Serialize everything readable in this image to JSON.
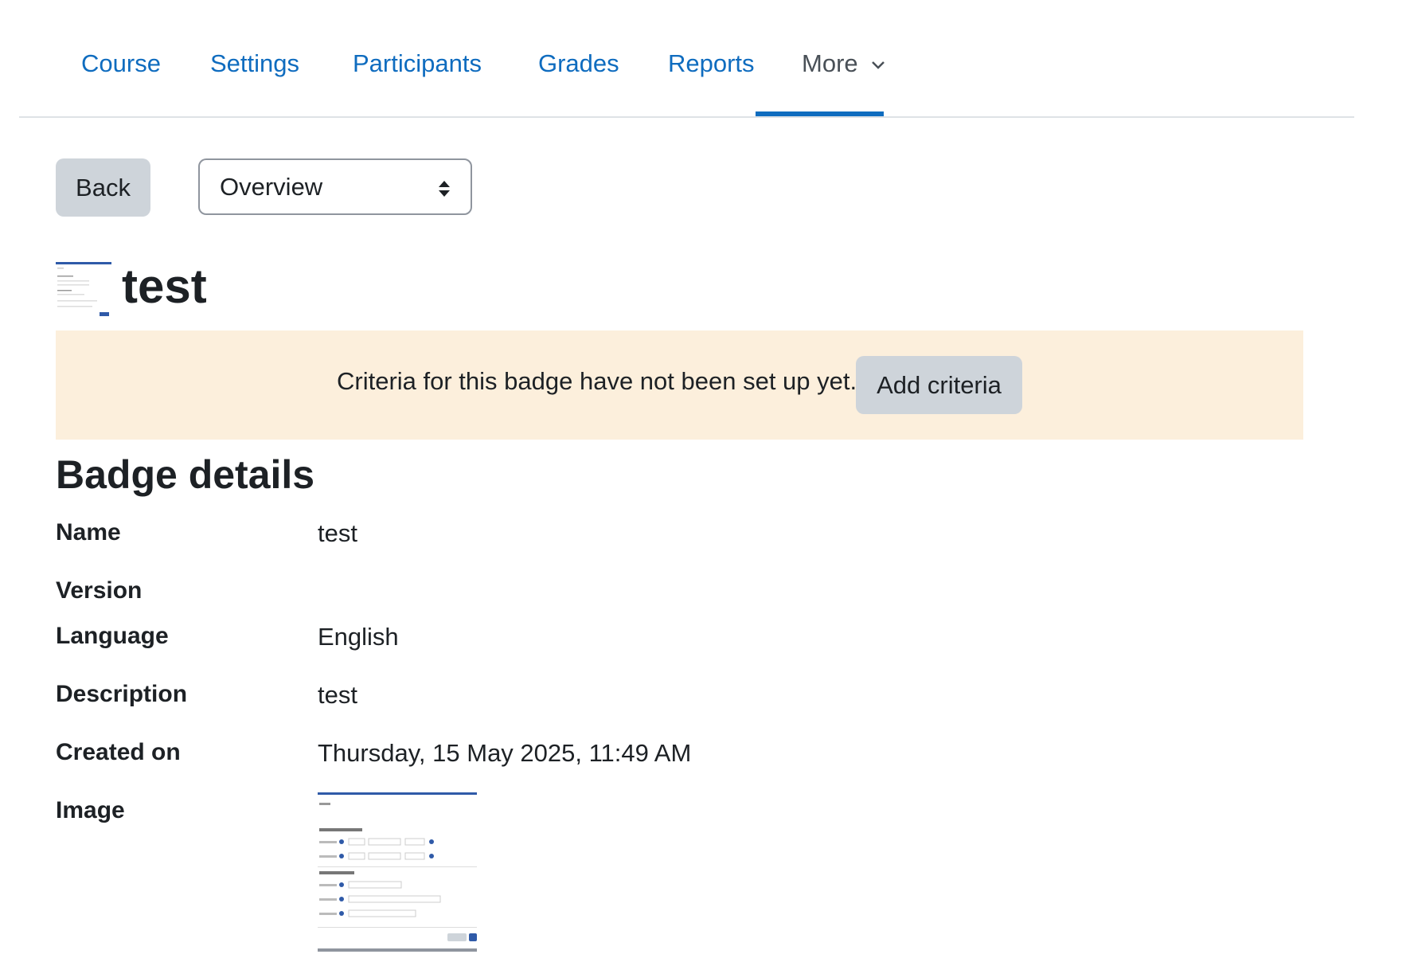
{
  "nav": {
    "tabs": [
      "Course",
      "Settings",
      "Participants",
      "Grades",
      "Reports"
    ],
    "more_label": "More",
    "active": "More"
  },
  "actions": {
    "back_label": "Back"
  },
  "page_select": {
    "selected": "Overview"
  },
  "page_title": "test",
  "alert": {
    "text": "Criteria for this badge have not been set up yet.",
    "button_label": "Add criteria"
  },
  "details": {
    "heading": "Badge details",
    "name_label": "Name",
    "name_value": "test",
    "version_label": "Version",
    "language_label": "Language",
    "language_value": "English",
    "description_label": "Description",
    "description_value": "test",
    "created_label": "Created on",
    "created_value": "Thursday, 15 May 2025, 11:49 AM",
    "image_label": "Image"
  },
  "colors": {
    "link": "#0f6cbf",
    "active_tab_text": "#495057",
    "alert_bg": "#fcefdc",
    "button_bg": "#ced4da"
  },
  "icons": {
    "more_dropdown": "chevron-down-icon",
    "select_caret": "sort-arrows-icon"
  }
}
